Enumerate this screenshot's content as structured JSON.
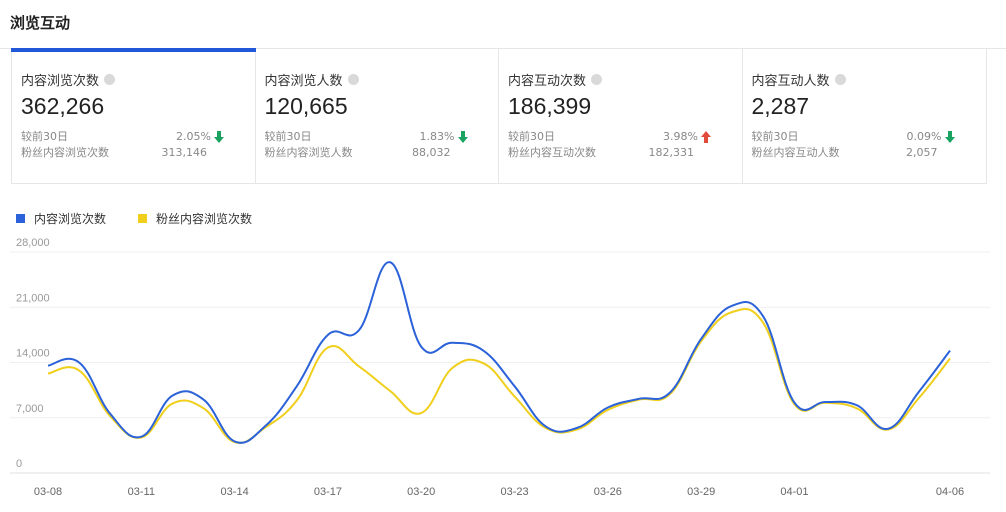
{
  "header": {
    "title": "浏览互动"
  },
  "cards": [
    {
      "title": "内容浏览次数",
      "value": "362,266",
      "compare_label": "较前30日",
      "change": "2.05%",
      "direction": "down",
      "sub_label": "粉丝内容浏览次数",
      "sub_value": "313,146"
    },
    {
      "title": "内容浏览人数",
      "value": "120,665",
      "compare_label": "较前30日",
      "change": "1.83%",
      "direction": "down",
      "sub_label": "粉丝内容浏览人数",
      "sub_value": "88,032"
    },
    {
      "title": "内容互动次数",
      "value": "186,399",
      "compare_label": "较前30日",
      "change": "3.98%",
      "direction": "up",
      "sub_label": "粉丝内容互动次数",
      "sub_value": "182,331"
    },
    {
      "title": "内容互动人数",
      "value": "2,287",
      "compare_label": "较前30日",
      "change": "0.09%",
      "direction": "down",
      "sub_label": "粉丝内容互动人数",
      "sub_value": "2,057"
    }
  ],
  "colors": {
    "accent": "#2058d8",
    "series1": "#2b62d9",
    "series2": "#f0cf1c",
    "down": "#1aa260",
    "up": "#e24b3b"
  },
  "chart_data": {
    "type": "line",
    "x": [
      "03-08",
      "03-09",
      "03-10",
      "03-11",
      "03-12",
      "03-13",
      "03-14",
      "03-15",
      "03-16",
      "03-17",
      "03-18",
      "03-19",
      "03-20",
      "03-21",
      "03-22",
      "03-23",
      "03-24",
      "03-25",
      "03-26",
      "03-27",
      "03-28",
      "03-29",
      "03-30",
      "03-31",
      "04-01",
      "04-02",
      "04-03",
      "04-04",
      "04-05",
      "04-06"
    ],
    "xticks": [
      "03-08",
      "03-11",
      "03-14",
      "03-17",
      "03-20",
      "03-23",
      "03-26",
      "03-29",
      "04-01",
      "04-06"
    ],
    "yticks": [
      0,
      7000,
      14000,
      21000,
      28000
    ],
    "ytick_labels": [
      "0",
      "7,000",
      "14,000",
      "21,000",
      "28,000"
    ],
    "ylim": [
      0,
      28000
    ],
    "grid": true,
    "legend_position": "top-left",
    "series": [
      {
        "name": "内容浏览次数",
        "values": [
          13600,
          14000,
          7500,
          4600,
          9800,
          9300,
          4000,
          6000,
          11000,
          17500,
          18100,
          26700,
          16000,
          16500,
          15500,
          11000,
          5900,
          5700,
          8300,
          9400,
          10200,
          17000,
          21200,
          19800,
          8900,
          9000,
          8600,
          5600,
          10300,
          15500
        ]
      },
      {
        "name": "粉丝内容浏览次数",
        "values": [
          12600,
          13000,
          7200,
          4500,
          8800,
          8200,
          3900,
          5800,
          9200,
          15900,
          13500,
          10400,
          7600,
          13300,
          13900,
          9700,
          5700,
          5500,
          8000,
          9300,
          10000,
          16700,
          20400,
          19000,
          8700,
          8900,
          8200,
          5500,
          9500,
          14500
        ]
      }
    ]
  }
}
